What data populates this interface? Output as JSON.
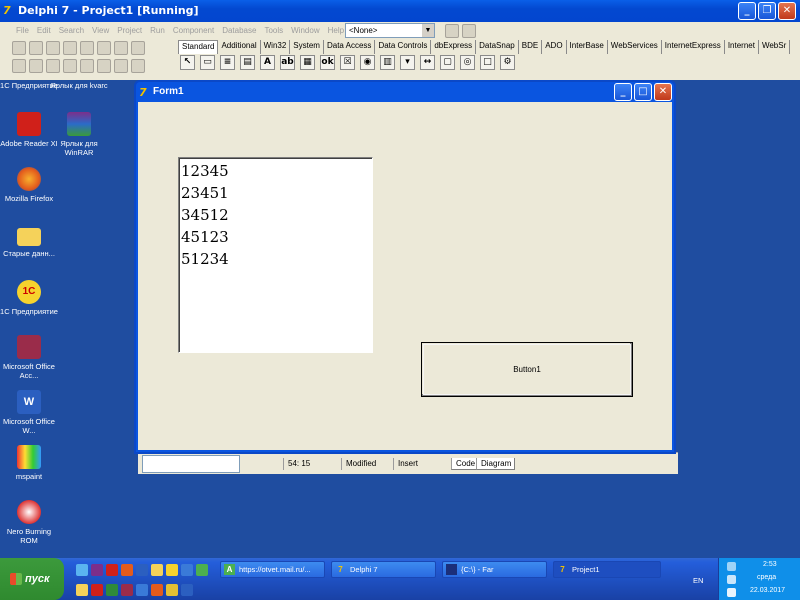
{
  "ide": {
    "title": "Delphi 7 - Project1 [Running]",
    "menu": [
      "File",
      "Edit",
      "Search",
      "View",
      "Project",
      "Run",
      "Component",
      "Database",
      "Tools",
      "Window",
      "Help"
    ],
    "combo_value": "<None>",
    "palette_tabs": [
      "Standard",
      "Additional",
      "Win32",
      "System",
      "Data Access",
      "Data Controls",
      "dbExpress",
      "DataSnap",
      "BDE",
      "ADO",
      "InterBase",
      "WebServices",
      "InternetExpress",
      "Internet",
      "WebSr"
    ]
  },
  "editor_status": {
    "position": "54: 15",
    "modified": "Modified",
    "mode": "Insert",
    "tabs": [
      "Code",
      "Diagram"
    ]
  },
  "form1": {
    "title": "Form1",
    "memo_lines": [
      "12345",
      "23451",
      "34512",
      "45123",
      "51234"
    ],
    "button_label": "Button1"
  },
  "desktop_icons": [
    {
      "label": "1C Предприятие",
      "icon": "1c-enterprise-icon"
    },
    {
      "label": "Ярлык для kvarc",
      "icon": "shortcut-icon"
    },
    {
      "label": "Adobe Reader XI",
      "icon": "adobe-reader-icon"
    },
    {
      "label": "Ярлык для WinRAR",
      "icon": "winrar-icon"
    },
    {
      "label": "Mozilla Firefox",
      "icon": "firefox-icon"
    },
    {
      "label": "Старые данн...",
      "icon": "folder-icon"
    },
    {
      "label": "1C Предприятие",
      "icon": "1c-enterprise-icon"
    },
    {
      "label": "Microsoft Office Acc...",
      "icon": "ms-access-icon"
    },
    {
      "label": "Microsoft Office W...",
      "icon": "ms-word-icon"
    },
    {
      "label": "mspaint",
      "icon": "mspaint-icon"
    },
    {
      "label": "Nero Burning ROM",
      "icon": "nero-icon"
    }
  ],
  "taskbar": {
    "start_label": "пуск",
    "buttons": [
      {
        "label": "https://otvet.mail.ru/...",
        "icon": "browser-icon"
      },
      {
        "label": "Delphi 7",
        "icon": "delphi-icon"
      },
      {
        "label": "{C:\\} - Far",
        "icon": "far-icon"
      },
      {
        "label": "Project1",
        "icon": "delphi-icon"
      }
    ],
    "lang": "EN",
    "time": "2:53",
    "day": "среда",
    "date": "22.03.2017"
  },
  "colors": {
    "desktop": "#1f4da0",
    "titlebar": "#0a55e0",
    "face": "#ece9d8"
  }
}
